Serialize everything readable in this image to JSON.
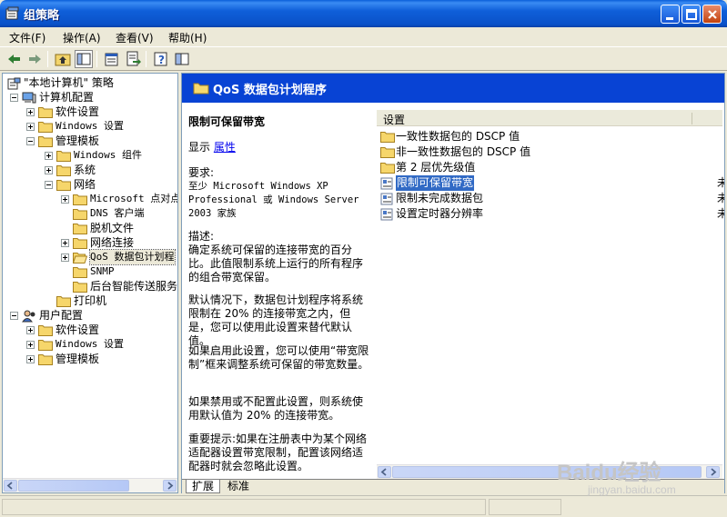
{
  "window": {
    "title": "组策略"
  },
  "menu": [
    "文件(F)",
    "操作(A)",
    "查看(V)",
    "帮助(H)"
  ],
  "tree": [
    {
      "label": "\"本地计算机\" 策略",
      "depth": 0,
      "expander": "",
      "icon": "policy-icon"
    },
    {
      "label": "计算机配置",
      "depth": 1,
      "expander": "minus",
      "icon": "computer-icon"
    },
    {
      "label": "软件设置",
      "depth": 2,
      "expander": "plus",
      "icon": "folder-icon"
    },
    {
      "label": "Windows 设置",
      "depth": 2,
      "expander": "plus",
      "icon": "folder-icon"
    },
    {
      "label": "管理模板",
      "depth": 2,
      "expander": "minus",
      "icon": "folder-icon"
    },
    {
      "label": "Windows 组件",
      "depth": 3,
      "expander": "plus",
      "icon": "folder-icon"
    },
    {
      "label": "系统",
      "depth": 3,
      "expander": "plus",
      "icon": "folder-icon"
    },
    {
      "label": "网络",
      "depth": 3,
      "expander": "minus",
      "icon": "folder-icon"
    },
    {
      "label": "Microsoft 点对点",
      "depth": 4,
      "expander": "plus",
      "icon": "folder-icon"
    },
    {
      "label": "DNS 客户端",
      "depth": 4,
      "expander": "",
      "icon": "folder-icon"
    },
    {
      "label": "脱机文件",
      "depth": 4,
      "expander": "",
      "icon": "folder-icon"
    },
    {
      "label": "网络连接",
      "depth": 4,
      "expander": "plus",
      "icon": "folder-icon"
    },
    {
      "label": "QoS 数据包计划程",
      "depth": 4,
      "expander": "plus",
      "icon": "folder-open-icon",
      "selected": true
    },
    {
      "label": "SNMP",
      "depth": 4,
      "expander": "",
      "icon": "folder-icon"
    },
    {
      "label": "后台智能传送服务",
      "depth": 4,
      "expander": "",
      "icon": "folder-icon"
    },
    {
      "label": "打印机",
      "depth": 3,
      "expander": "",
      "icon": "folder-icon"
    },
    {
      "label": "用户配置",
      "depth": 1,
      "expander": "minus",
      "icon": "user-icon"
    },
    {
      "label": "软件设置",
      "depth": 2,
      "expander": "plus",
      "icon": "folder-icon"
    },
    {
      "label": "Windows 设置",
      "depth": 2,
      "expander": "plus",
      "icon": "folder-icon"
    },
    {
      "label": "管理模板",
      "depth": 2,
      "expander": "plus",
      "icon": "folder-icon"
    }
  ],
  "right": {
    "header_title": "QoS 数据包计划程序",
    "desc_title": "限制可保留带宽",
    "show_label": "显示",
    "properties_link": "属性",
    "requirements_label": "要求:",
    "requirements_text": "至少 Microsoft Windows XP Professional 或 Windows Server 2003 家族",
    "description_label": "描述:",
    "description_text": "确定系统可保留的连接带宽的百分比。此值限制系统上运行的所有程序的组合带宽保留。",
    "default_text": "默认情况下，数据包计划程序将系统限制在 20% 的连接带宽之内，但是，您可以使用此设置来替代默认值。",
    "enabled_text": "如果启用此设置，您可以使用“带宽限制”框来调整系统可保留的带宽数量。",
    "disabled_text": "如果禁用或不配置此设置，则系统使用默认值为 20% 的连接带宽。",
    "important_text": "重要提示:如果在注册表中为某个网络适配器设置带宽限制，配置该网络适配器时就会忽略此设置。",
    "list_header": "设置",
    "list_items": [
      {
        "label": "一致性数据包的 DSCP 值",
        "icon": "folder-icon",
        "state": ""
      },
      {
        "label": "非一致性数据包的 DSCP 值",
        "icon": "folder-icon",
        "state": ""
      },
      {
        "label": "第 2 层优先级值",
        "icon": "folder-icon",
        "state": ""
      },
      {
        "label": "限制可保留带宽",
        "icon": "setting-icon",
        "state": "未",
        "selected": true
      },
      {
        "label": "限制未完成数据包",
        "icon": "setting-icon",
        "state": "未"
      },
      {
        "label": "设置定时器分辨率",
        "icon": "setting-icon",
        "state": "未"
      }
    ],
    "tabs": [
      "扩展",
      "标准"
    ]
  },
  "watermark": {
    "brand": "Baidu经验",
    "url": "jingyan.baidu.com"
  },
  "colors": {
    "titlebar": "#0a51c8",
    "header_band": "#0843d4",
    "selection": "#316ac5"
  }
}
